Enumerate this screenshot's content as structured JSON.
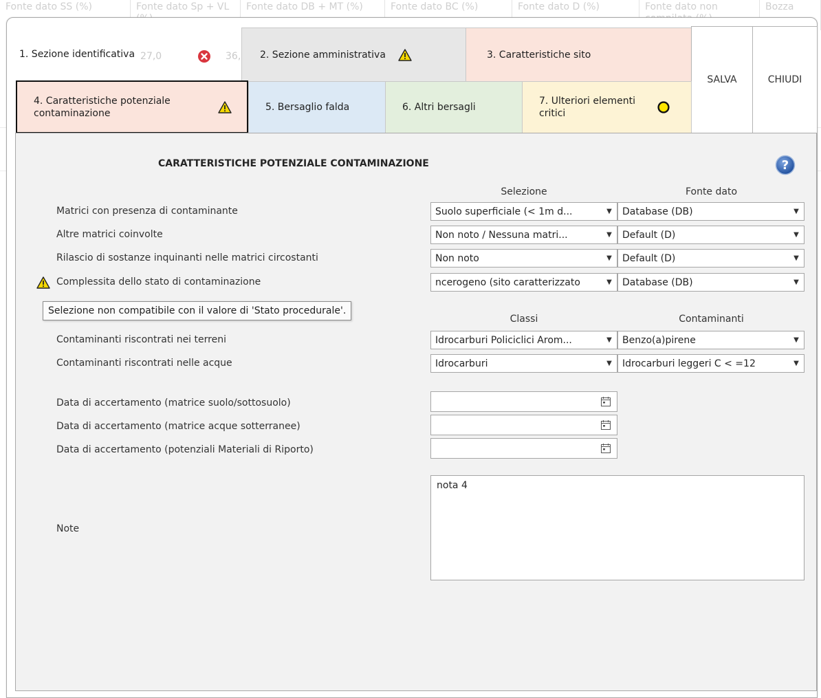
{
  "background_grid": {
    "headers": [
      "Fonte dato SS (%)",
      "Fonte dato Sp + VL (%)",
      "Fonte dato DB + MT (%)",
      "Fonte dato BC (%)",
      "Fonte dato D (%)",
      "Fonte dato non compilata (%)",
      "Bozza"
    ],
    "partial_values": [
      "27,0",
      "36,"
    ]
  },
  "tabs": [
    {
      "label": "1. Sezione identificativa",
      "status": "error-icon"
    },
    {
      "label": "2. Sezione amministrativa",
      "status": "warning-icon"
    },
    {
      "label": "3. Caratteristiche sito",
      "status": ""
    },
    {
      "label": "4. Caratteristiche potenziale contaminazione",
      "status": "warning-icon"
    },
    {
      "label": "5. Bersaglio falda",
      "status": ""
    },
    {
      "label": "6. Altri bersagli",
      "status": ""
    },
    {
      "label": "7. Ulteriori elementi critici",
      "status": "yellow-circle-icon"
    }
  ],
  "tab_colors": {
    "tab1": "#ffffff",
    "tab2": "#e7e7e7",
    "tab3": "#fbe4dc",
    "tab4": "#fbe4dc",
    "tab5": "#dce9f5",
    "tab6": "#e3efdd",
    "tab7": "#fdf3d5"
  },
  "actions": {
    "save": "SALVA",
    "close": "CHIUDI"
  },
  "section": {
    "title": "CARATTERISTICHE POTENZIALE CONTAMINAZIONE"
  },
  "columns": {
    "selezione": "Selezione",
    "fonte_dato": "Fonte dato",
    "classi": "Classi",
    "contaminanti": "Contaminanti"
  },
  "rows": [
    {
      "label": "Matrici con presenza di contaminante",
      "selection": "Suolo superficiale (< 1m d...",
      "source": "Database (DB)"
    },
    {
      "label": "Altre matrici coinvolte",
      "selection": "Non noto / Nessuna matri...",
      "source": "Default (D)"
    },
    {
      "label": "Rilascio di sostanze inquinanti nelle matrici circostanti",
      "selection": "Non noto",
      "source": "Default (D)"
    },
    {
      "label": "Complessita dello stato di contaminazione",
      "selection": "ncerogeno (sito caratterizzato",
      "source": "Database (DB)"
    }
  ],
  "tooltip": "Selezione non compatibile con il valore di 'Stato procedurale'.",
  "contaminant_rows": [
    {
      "label": "Contaminanti riscontrati nei terreni",
      "class": "Idrocarburi Policiclici Arom...",
      "contaminant": "Benzo(a)pirene"
    },
    {
      "label": "Contaminanti riscontrati nelle acque",
      "class": "Idrocarburi",
      "contaminant": "Idrocarburi leggeri C < =12"
    }
  ],
  "dates": [
    {
      "label": "Data di accertamento (matrice suolo/sottosuolo)",
      "value": ""
    },
    {
      "label": "Data di accertamento (matrice acque sotterranee)",
      "value": ""
    },
    {
      "label": "Data di accertamento (potenziali Materiali di Riporto)",
      "value": ""
    }
  ],
  "notes": {
    "label": "Note",
    "value": "nota  4"
  }
}
